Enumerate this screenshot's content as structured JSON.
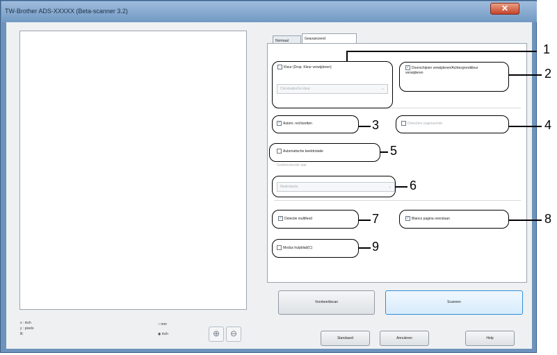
{
  "window": {
    "title": "TW-Brother ADS-XXXXX (Beta-scanner 3.2)",
    "close_glyph": "✕"
  },
  "tabs": {
    "basic": "Normaal",
    "advanced": "Geavanceerd"
  },
  "options": {
    "color_drop": {
      "label": "Kleur (Drop. Kleur verwijderen)",
      "checked": false,
      "dropdown": "Chromatische kleur",
      "dropdown_arrow": "⌄"
    },
    "remove_bleed": {
      "label": "Doorschijnen verwijderen/Achtergrondkleur verwijderen",
      "checked": true,
      "check_glyph": "✓"
    },
    "auto_deskew": {
      "label": "Autom. rechtzetten",
      "checked": true,
      "check_glyph": "✓"
    },
    "detect_page_end": {
      "label": "Detecteer paginaeinde",
      "checked": false
    },
    "auto_rotate": {
      "label": "Automatische beeldrotatie",
      "checked": false
    },
    "rotate_language_label": "Gedetecteerde taal",
    "rotate_language": "Nederlands",
    "rotate_language_arrow": "⌄",
    "multifeed": {
      "label": "Detectie multifeed",
      "checked": true,
      "check_glyph": "✓"
    },
    "skip_blank": {
      "label": "Blanco pagina overslaan",
      "checked": true,
      "check_glyph": "✓"
    },
    "carrier_mode": {
      "label": "Modus hulpblad(C)",
      "checked": false
    }
  },
  "callouts": [
    "1",
    "2",
    "3",
    "4",
    "5",
    "6",
    "7",
    "8",
    "9"
  ],
  "buttons": {
    "preview": "Voorbeeldscan",
    "scan": "Scannen",
    "default": "Standaard",
    "cancel": "Annuleren",
    "help": "Help"
  },
  "footer": {
    "legend": [
      "x : inch",
      "y : pixels",
      "B:"
    ],
    "unit_mm": "mm",
    "unit_inch": "inch",
    "unit_mm_radio": "○",
    "unit_inch_radio": "◉",
    "zoom_in_glyph": "⊕",
    "zoom_out_glyph": "⊖"
  }
}
